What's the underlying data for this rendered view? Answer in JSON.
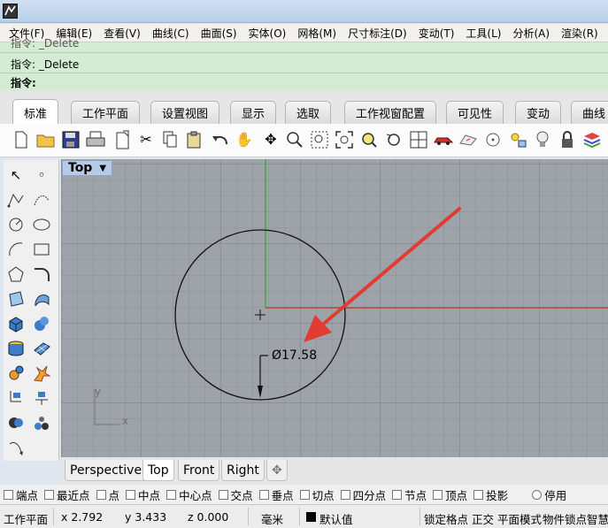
{
  "menubar": {
    "items": [
      "文件(F)",
      "编辑(E)",
      "查看(V)",
      "曲线(C)",
      "曲面(S)",
      "实体(O)",
      "网格(M)",
      "尺寸标注(D)",
      "变动(T)",
      "工具(L)",
      "分析(A)",
      "渲染(R)"
    ]
  },
  "command": {
    "history_1": "指令: _Delete",
    "history_2": "指令: _Delete",
    "prompt": "指令:"
  },
  "tabs": [
    "标准",
    "工作平面",
    "设置视图",
    "显示",
    "选取",
    "工作视窗配置",
    "可见性",
    "变动",
    "曲线"
  ],
  "toolbar_icons": [
    "new-file-icon",
    "open-folder-icon",
    "save-icon",
    "print-icon",
    "import-icon",
    "cut-icon",
    "copy-icon",
    "paste-icon",
    "undo-icon",
    "pan-hand-icon",
    "rotate-view-icon",
    "zoom-icon",
    "zoom-window-icon",
    "zoom-extents-icon",
    "zoom-selected-icon",
    "undo-view-icon",
    "four-viewports-icon",
    "car-icon",
    "render-icon",
    "circle-icon",
    "light-icon",
    "bulb-icon",
    "lock-icon",
    "material-icon"
  ],
  "viewport": {
    "name": "Top",
    "dimension_text": "Ø17.58",
    "axis_y": "y",
    "axis_x": "x"
  },
  "viewport_tabs": [
    "Perspective",
    "Top",
    "Front",
    "Right"
  ],
  "osnaps": [
    "端点",
    "最近点",
    "点",
    "中点",
    "中心点",
    "交点",
    "垂点",
    "切点",
    "四分点",
    "节点",
    "顶点",
    "投影"
  ],
  "osnap_disable": "停用",
  "status": {
    "cplane": "工作平面",
    "x": "x 2.792",
    "y": "y 3.433",
    "z": "z 0.000",
    "units": "毫米",
    "layer": "默认值",
    "grid_snap": "锁定格点",
    "ortho": "正交",
    "planar": "平面模式",
    "object_snap": "物件锁点",
    "smart_track": "智慧"
  },
  "colors": {
    "accent_arrow": "#e23b31",
    "x_axis": "#b8413e",
    "y_axis": "#44a83f",
    "viewport_bg": "#9ea3a9",
    "command_bg": "#d4ecd4"
  }
}
